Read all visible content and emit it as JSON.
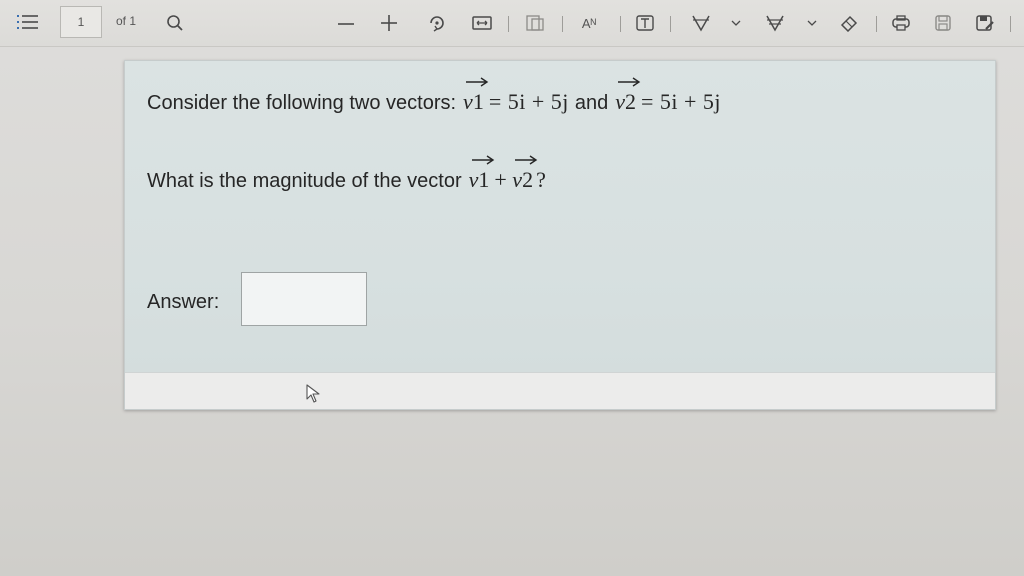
{
  "toolbar": {
    "page_number": "1",
    "page_of": "of 1",
    "font_size_label": "Aᴺ",
    "icons": [
      "list-icon",
      "search-icon",
      "zoom-out-icon",
      "zoom-in-icon",
      "rotate-icon",
      "fit-width-icon",
      "page-view-icon",
      "text-size-icon",
      "text-box-icon",
      "draw-icon",
      "highlight-icon",
      "erase-icon",
      "print-icon",
      "save-icon",
      "save-as-icon"
    ]
  },
  "question": {
    "line1_prefix": "Consider the following two vectors:",
    "v1_name": "v",
    "v1_index": "1",
    "v1_value": "= 5i + 5j",
    "connector": "and",
    "v2_name": "v",
    "v2_index": "2",
    "v2_value": "= 5i + 5j",
    "line2_prefix": "What is the magnitude of the vector",
    "plus": "+",
    "suffix": "?"
  },
  "answer": {
    "label": "Answer:",
    "value": "",
    "placeholder": ""
  },
  "colors": {
    "card_background": "#d8e0e0",
    "page_background": "#d9d8d5",
    "toolbar_background": "#dfdedb"
  }
}
